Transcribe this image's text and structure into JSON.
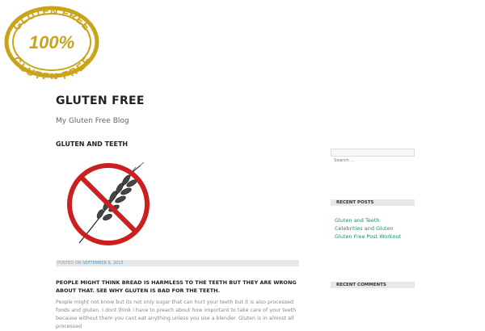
{
  "site": {
    "title": "GLUTEN FREE",
    "description": "My Gluten Free Blog"
  },
  "logo": {
    "top_text": "GLUTEN FREE",
    "middle_text": "100%",
    "bottom_text": "GLUTEN FREE",
    "color": "#c9a419"
  },
  "post": {
    "title": "GLUTEN AND TEETH",
    "image_icon": "no-wheat-icon",
    "meta_prefix": "POSTED ON",
    "date": "SEPTEMBER 6, 2015",
    "lead": "PEOPLE MIGHT THINK BREAD IS HARMLESS TO THE TEETH BUT THEY ARE WRONG ABOUT THAT. SEE WHY GLUTEN IS BAD FOR THE TEETH.",
    "body": "People might not know but its not only sugar that can hurt your teeth but it is also processed foods and gluten. I dont think i have to preach about how important to take care of your teeth because without them you cant eat anything unless you use a blender. Gluten is in almost all processed"
  },
  "sidebar": {
    "search_placeholder": "Search …",
    "recent_posts_title": "RECENT POSTS",
    "recent_posts": [
      "Gluten and Teeth",
      "Celebrities and Gluten",
      "Gluten Free Post Workout"
    ],
    "recent_comments_title": "RECENT COMMENTS",
    "link_color": "#2a8a66"
  }
}
